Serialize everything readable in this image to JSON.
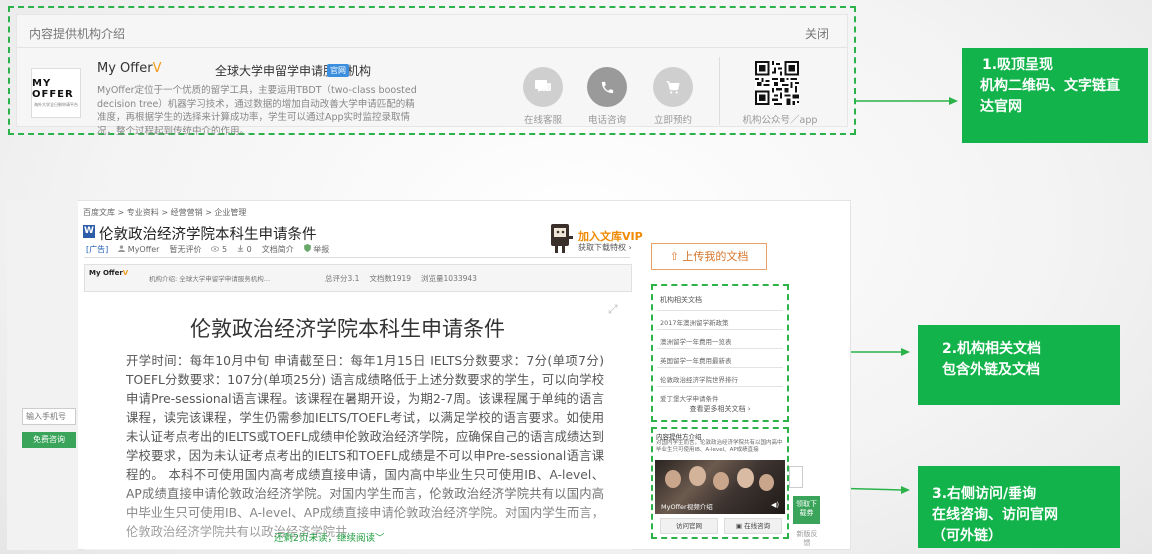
{
  "top_panel": {
    "header_title": "内容提供机构介绍",
    "close_label": "关闭",
    "logo_line1": "MY OFFER",
    "logo_line2": "海外大学全日制申请平台",
    "org_name": "My Offer",
    "org_name_suffix": "V",
    "org_tagline": "全球大学申留学申请服务机构",
    "official_badge": "官网",
    "org_description": "MyOffer定位于一个优质的留学工具，主要运用TBDT（two-class boosted decision tree）机器学习技术，通过数据的增加自动改善大学申请匹配的精准度，再根据学生的选择来计算成功率，学生可以通过App实时监控录取情况，整个过程起到传统中介的作用。",
    "actions": [
      {
        "label": "在线客服",
        "icon": "chat-icon"
      },
      {
        "label": "电话咨询",
        "icon": "phone-icon"
      },
      {
        "label": "立即预约",
        "icon": "cart-icon"
      }
    ],
    "qr_label": "机构公众号／app"
  },
  "callouts": {
    "c1_line1": "1.吸顶呈现",
    "c1_line2": "机构二维码、文字链直",
    "c1_line3": "达官网",
    "c2_line1": "2.机构相关文档",
    "c2_line2": "包含外链及文档",
    "c3_line1": "3.右侧访问/垂询",
    "c3_line2": "在线咨询、访问官网",
    "c3_line3": "（可外链）"
  },
  "doc": {
    "breadcrumb": "百度文库 > 专业资料 > 经营营销 > 企业管理",
    "title": "伦敦政治经济学院本科生申请条件",
    "meta_ad": "[广告]",
    "meta_author": "MyOffer",
    "meta_rating": "暂无评价",
    "meta_views": "5",
    "meta_downloads": "0",
    "meta_intro": "文档简介",
    "meta_report": "举报",
    "vip_title": "加入文库VIP",
    "vip_sub": "获取下载特权 ›",
    "infobar_logo": "My Offer",
    "infobar_logo_suffix": "V",
    "infobar_intro": "机构介绍:  全球大学申留学申请服务机构…",
    "infobar_stats": [
      "总评分3.1",
      "文档数1919",
      "浏览量1033943"
    ],
    "content_title": "伦敦政治经济学院本科生申请条件",
    "content_body": "开学时间：每年10月中旬 申请截至日：每年1月15日 IELTS分数要求：7分(单项7分) TOEFL分数要求：107分(单项25分) 语言成绩略低于上述分数要求的学生，可以向学校申请Pre-sessional语言课程。该课程在暑期开设，为期2-7周。该课程属于单纯的语言课程，读完该课程，学生仍需参加IELTS/TOEFL考试，以满足学校的语言要求。如使用未认证考点考出的IELTS或TOEFL成绩申伦敦政治经济学院，应确保自己的语言成绩达到学校要求，因为未认证考点考出的IELTS和TOEFL成绩是不可以申Pre-sessional语言课程的。 本科不可使用国内高考成绩直接申请，国内高中毕业生只可使用IB、A-level、AP成绩直接申请伦敦政治经济学院。对国内学生而言，伦敦政治经济学院共有以国内高中毕业生只可使用IB、A-level、AP成绩直接申请伦敦政治经济学院。对国内学生而言，伦敦政治经济学院共有以政治经济学院共",
    "continue_label": "还剩2页未读，继续阅读",
    "phone_placeholder": "输入手机号",
    "free_consult": "免费咨询"
  },
  "sidebar": {
    "upload_label": "上传我的文档",
    "related_title": "机构相关文档",
    "related_items": [
      "2017年澳洲留学新政策",
      "澳洲留学一年费用一览表",
      "英国留学一年费用最新表",
      "伦敦政治经济学院世界排行",
      "爱丁堡大学申请条件"
    ],
    "related_more": "查看更多相关文档",
    "provider_title": "内容提供方介绍",
    "provider_desc": "对国内学生而言，伦敦政治经济学院共有以国内高中毕业生只可使用IB、A-level、AP成绩直接",
    "photo_caption": "MyOffer视频介绍",
    "visit_site": "访问官网",
    "online_consult": "在线咨询",
    "side_get": "领取下载券",
    "side_new": "新版反馈"
  },
  "colors": {
    "callout_green": "#12b34a",
    "dashed_green": "#2bb34a",
    "upload_orange": "#d6762c",
    "brand_v": "#f19b1b"
  }
}
